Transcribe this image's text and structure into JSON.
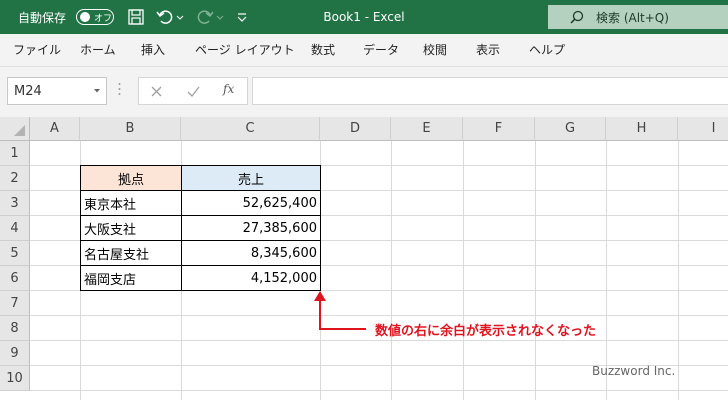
{
  "titlebar": {
    "autosave_label": "自動保存",
    "autosave_state": "オフ",
    "document_title": "Book1  -  Excel",
    "search_label": "検索 (Alt+Q)",
    "bg_color": "#217346"
  },
  "menu": {
    "items": [
      "ファイル",
      "ホーム",
      "挿入",
      "ページ レイアウト",
      "数式",
      "データ",
      "校閲",
      "表示",
      "ヘルプ"
    ]
  },
  "formula_bar": {
    "name_box": "M24",
    "function_symbol": "fx",
    "formula": ""
  },
  "grid": {
    "columns": [
      "A",
      "B",
      "C",
      "D",
      "E",
      "F",
      "G",
      "H",
      "I"
    ],
    "rows": [
      "1",
      "2",
      "3",
      "4",
      "5",
      "6",
      "7",
      "8",
      "9",
      "10"
    ]
  },
  "table": {
    "headers": [
      "拠点",
      "売上"
    ],
    "header_colors": [
      "#fce4d6",
      "#ddebf7"
    ],
    "rows": [
      {
        "name": "東京本社",
        "value": "52,625,400"
      },
      {
        "name": "大阪支社",
        "value": "27,385,600"
      },
      {
        "name": "名古屋支社",
        "value": "8,345,600"
      },
      {
        "name": "福岡支店",
        "value": "4,152,000"
      }
    ]
  },
  "annotation": {
    "text": "数値の右に余白が表示されなくなった",
    "color": "#e0141e"
  },
  "watermark": "Buzzword Inc."
}
